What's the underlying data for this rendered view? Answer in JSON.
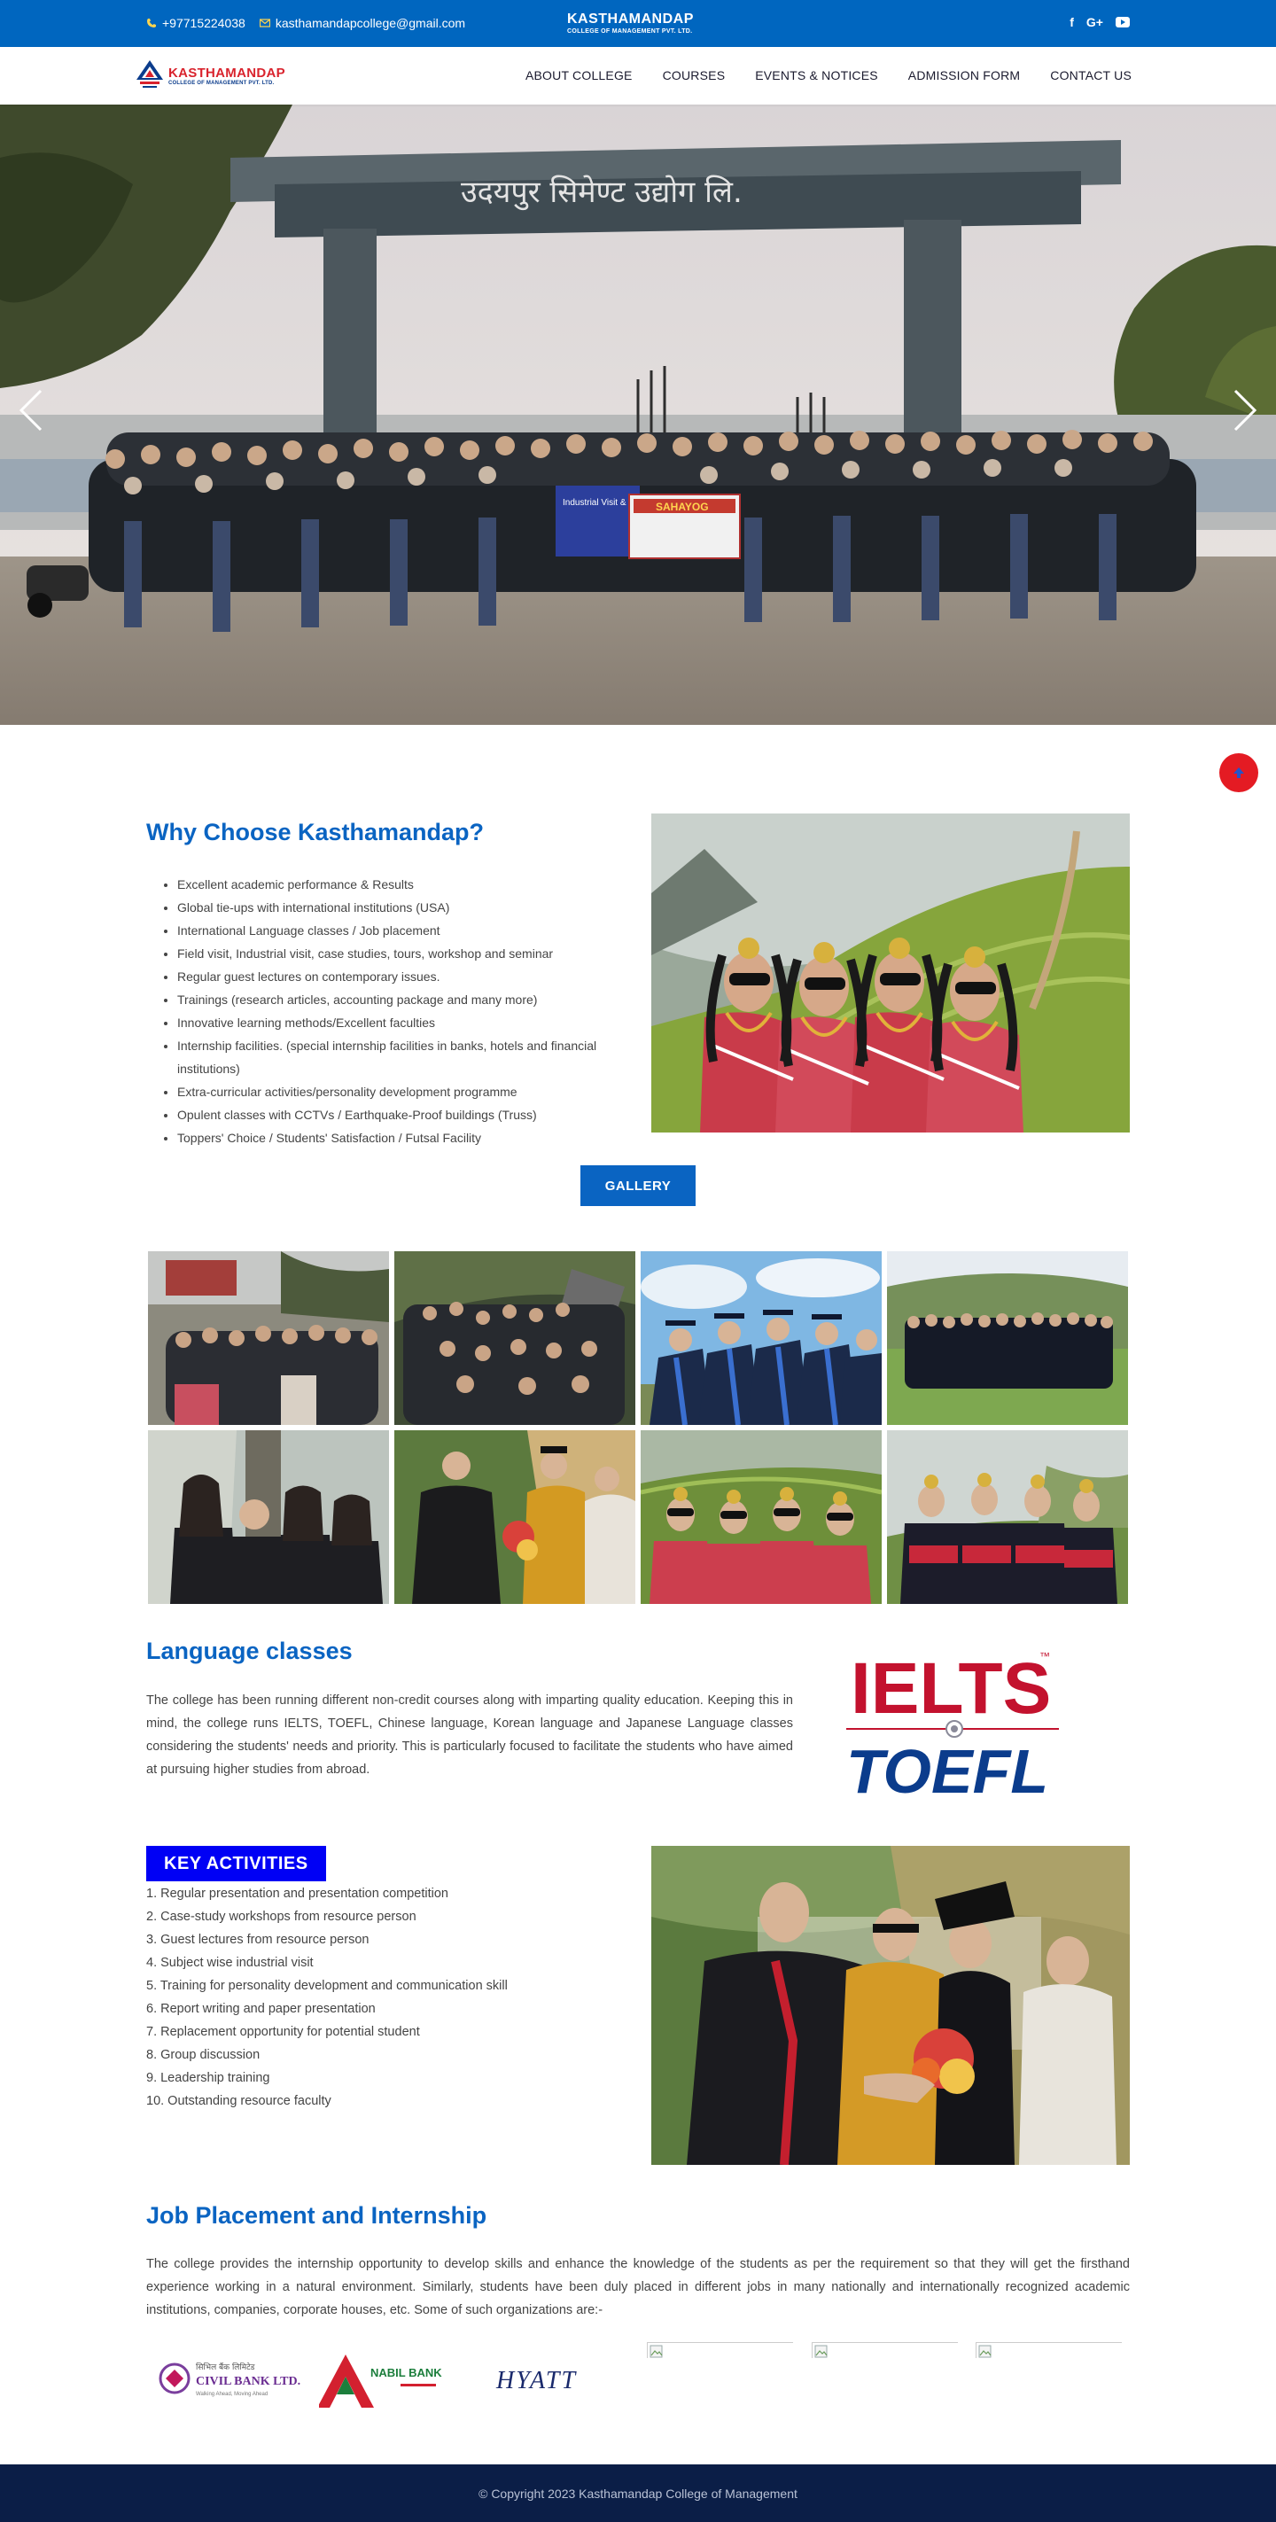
{
  "topbar": {
    "phone": "+97715224038",
    "email": "kasthamandapcollege@gmail.com",
    "brand_name": "KASTHAMANDAP",
    "brand_sub": "COLLEGE OF MANAGEMENT PVT. LTD.",
    "social": [
      "f",
      "G+",
      "youtube"
    ]
  },
  "nav": {
    "logo_name": "KASTHAMANDAP",
    "logo_sub": "COLLEGE OF MANAGEMENT PVT. LTD.",
    "items": [
      "ABOUT COLLEGE",
      "COURSES",
      "EVENTS & NOTICES",
      "ADMISSION FORM",
      "CONTACT US"
    ]
  },
  "hero": {
    "gate_sign": "उदयपुर सिमेण्ट उद्योग लि.",
    "banner_1": "Industrial Visit & Excursion-2079",
    "banner_2": "SAHAYOG"
  },
  "why": {
    "title": "Why Choose Kasthamandap?",
    "items": [
      "Excellent academic performance & Results",
      "Global tie-ups with international institutions (USA)",
      "International Language classes / Job placement",
      "Field visit, Industrial visit, case studies, tours, workshop and seminar",
      "Regular guest lectures on contemporary issues.",
      "Trainings (research articles, accounting package and many more)",
      "Innovative learning methods/Excellent faculties",
      "Internship facilities. (special internship facilities in banks, hotels and financial institutions)",
      "Extra-curricular activities/personality development programme",
      "Opulent classes with CCTVs / Earthquake-Proof buildings (Truss)",
      "Toppers' Choice / Students' Satisfaction / Futsal Facility"
    ]
  },
  "gallery": {
    "button": "GALLERY"
  },
  "language": {
    "title": "Language classes",
    "text": "The college has been running different non-credit courses along with imparting quality education. Keeping this in mind, the college runs IELTS, TOEFL, Chinese language, Korean language and Japanese Language classes considering the students' needs and priority. This is particularly focused to facilitate the students who have aimed at pursuing higher studies from abroad.",
    "logo_top": "IELTS",
    "logo_bottom": "TOEFL"
  },
  "activities": {
    "title": "KEY ACTIVITIES",
    "items": [
      "1. Regular presentation and presentation competition",
      "2. Case-study workshops from resource person",
      "3. Guest lectures from resource person",
      "4. Subject wise industrial visit",
      "5. Training for personality development and communication skill",
      "6. Report writing and paper presentation",
      "7. Replacement opportunity for potential student",
      "8. Group discussion",
      "9. Leadership training",
      "10. Outstanding resource faculty"
    ]
  },
  "job": {
    "title": "Job Placement and Internship",
    "text": "The college provides the internship opportunity to develop skills and enhance the knowledge of the students as per the requirement so that they will get the firsthand experience working in a natural environment. Similarly, students have been duly placed in different jobs in many nationally and internationally recognized academic institutions, companies, corporate houses, etc. Some of such organizations are:-",
    "partners": [
      "CIVIL BANK LTD.",
      "NABIL BANK",
      "HYATT"
    ],
    "civil_tagline": "Walking Ahead, Moving Ahead",
    "civil_nepali": "सिभिल बैंक लिमिटेड"
  },
  "footer": {
    "copyright": "© Copyright 2023 Kasthamandap College of Management"
  },
  "colors": {
    "primary": "#0066bf",
    "heading": "#0a64c2",
    "badge": "#0000f5",
    "footer": "#0b1e47",
    "red": "#e41b23"
  }
}
